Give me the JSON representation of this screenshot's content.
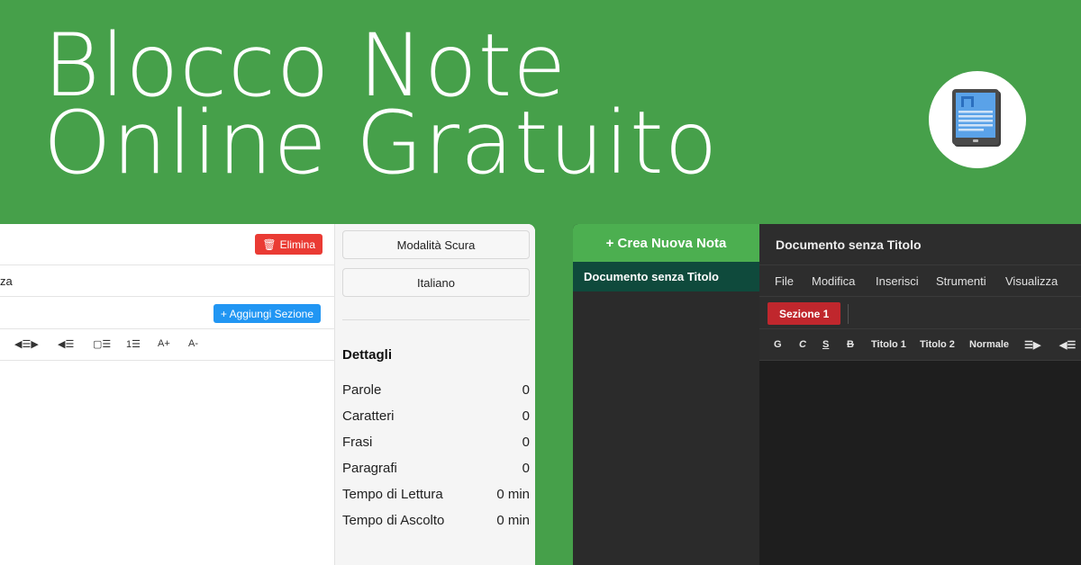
{
  "hero": {
    "line1": "Blocco Note",
    "line2": "Online Gratuito"
  },
  "light": {
    "delete_label": "Elimina",
    "menu_fragment": "za",
    "add_section_label": "+ Aggiungi Sezione",
    "toolbar": [
      "◀☰▶",
      "◀☰",
      "▢☰",
      "1☰",
      "A+",
      "A-"
    ],
    "sidebar": {
      "dark_mode_label": "Modalità Scura",
      "language_label": "Italiano",
      "details_title": "Dettagli",
      "stats": [
        {
          "label": "Parole",
          "value": "0"
        },
        {
          "label": "Caratteri",
          "value": "0"
        },
        {
          "label": "Frasi",
          "value": "0"
        },
        {
          "label": "Paragrafi",
          "value": "0"
        },
        {
          "label": "Tempo di Lettura",
          "value": "0 min"
        },
        {
          "label": "Tempo di Ascolto",
          "value": "0 min"
        }
      ]
    }
  },
  "dark": {
    "create_note_label": "+ Crea Nuova Nota",
    "active_note": "Documento senza Titolo",
    "doc_title": "Documento senza Titolo",
    "menu": [
      "File",
      "Modifica",
      "Inserisci",
      "Strumenti",
      "Visualizza"
    ],
    "section_label": "Sezione 1",
    "toolbar": [
      "G",
      "C",
      "S",
      "B",
      "Titolo 1",
      "Titolo 2",
      "Normale",
      "☰▶",
      "◀☰"
    ]
  },
  "colors": {
    "brand_green": "#46a04a",
    "delete_red": "#ea3b34",
    "add_blue": "#2196f3",
    "section_red": "#c0272d"
  },
  "icons": {
    "logo": "notepad-tablet-icon",
    "delete": "trash-icon"
  }
}
